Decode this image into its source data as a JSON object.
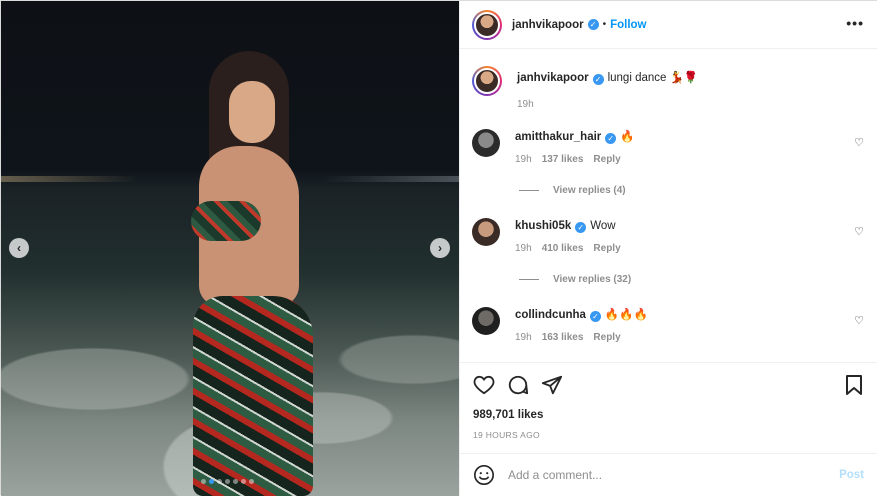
{
  "post": {
    "author": "janhvikapoor",
    "follow_label": "Follow",
    "separator": "•",
    "more_label": "•••",
    "caption_text": "lungi dance 💃🌹",
    "caption_time": "19h",
    "carousel_dots": 7,
    "active_dot": 1
  },
  "comments": [
    {
      "user": "amitthakur_hair",
      "text": "🔥",
      "time": "19h",
      "likes": "137 likes",
      "reply": "Reply",
      "view_replies": "View replies (4)",
      "verified": true
    },
    {
      "user": "khushi05k",
      "text": "Wow",
      "time": "19h",
      "likes": "410 likes",
      "reply": "Reply",
      "view_replies": "View replies (32)",
      "verified": true
    },
    {
      "user": "collindcunha",
      "text": "🔥🔥🔥",
      "time": "19h",
      "likes": "163 likes",
      "reply": "Reply",
      "verified": true
    }
  ],
  "footer": {
    "likes": "989,701 likes",
    "timestamp": "19 HOURS AGO",
    "comment_placeholder": "Add a comment...",
    "post_label": "Post"
  },
  "icons": {
    "like": "heart-icon",
    "comment": "comment-icon",
    "share": "share-icon",
    "save": "bookmark-icon",
    "emoji": "emoji-icon"
  },
  "colors": {
    "follow": "#0095f6",
    "verified": "#3897f0",
    "post_disabled": "#b2dffc"
  }
}
